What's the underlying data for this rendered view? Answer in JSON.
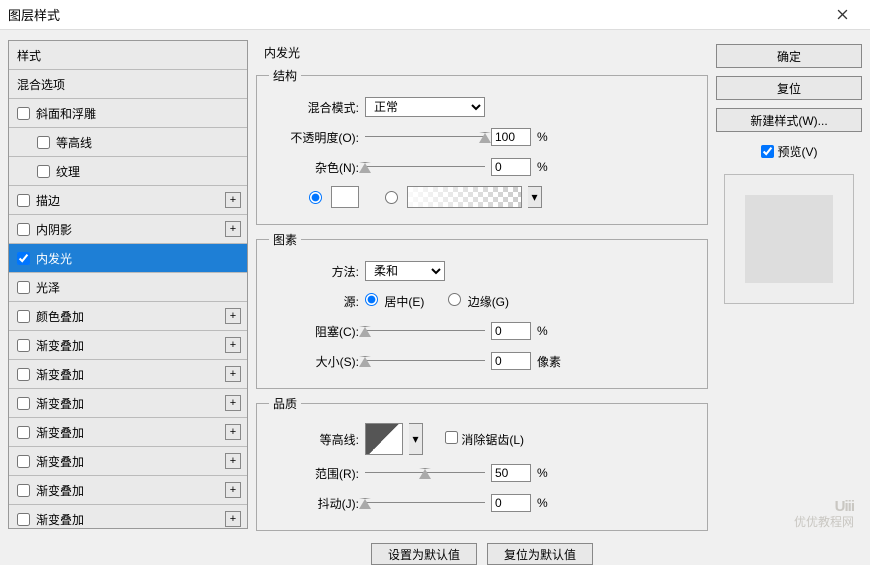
{
  "window": {
    "title": "图层样式"
  },
  "left": {
    "header1": "样式",
    "header2": "混合选项",
    "items": [
      {
        "label": "斜面和浮雕",
        "checked": false,
        "plus": false,
        "sub": false
      },
      {
        "label": "等高线",
        "checked": false,
        "plus": false,
        "sub": true
      },
      {
        "label": "纹理",
        "checked": false,
        "plus": false,
        "sub": true
      },
      {
        "label": "描边",
        "checked": false,
        "plus": true,
        "sub": false
      },
      {
        "label": "内阴影",
        "checked": false,
        "plus": true,
        "sub": false
      },
      {
        "label": "内发光",
        "checked": true,
        "plus": false,
        "sub": false,
        "selected": true
      },
      {
        "label": "光泽",
        "checked": false,
        "plus": false,
        "sub": false
      },
      {
        "label": "颜色叠加",
        "checked": false,
        "plus": true,
        "sub": false
      },
      {
        "label": "渐变叠加",
        "checked": false,
        "plus": true,
        "sub": false
      },
      {
        "label": "渐变叠加",
        "checked": false,
        "plus": true,
        "sub": false
      },
      {
        "label": "渐变叠加",
        "checked": false,
        "plus": true,
        "sub": false
      },
      {
        "label": "渐变叠加",
        "checked": false,
        "plus": true,
        "sub": false
      },
      {
        "label": "渐变叠加",
        "checked": false,
        "plus": true,
        "sub": false
      },
      {
        "label": "渐变叠加",
        "checked": false,
        "plus": true,
        "sub": false
      },
      {
        "label": "渐变叠加",
        "checked": false,
        "plus": true,
        "sub": false
      }
    ]
  },
  "mid": {
    "title": "内发光",
    "structure": {
      "legend": "结构",
      "blend_label": "混合模式:",
      "blend_value": "正常",
      "opacity_label": "不透明度(O):",
      "opacity_value": "100",
      "opacity_unit": "%",
      "noise_label": "杂色(N):",
      "noise_value": "0",
      "noise_unit": "%"
    },
    "element": {
      "legend": "图素",
      "method_label": "方法:",
      "method_value": "柔和",
      "source_label": "源:",
      "source_center": "居中(E)",
      "source_edge": "边缘(G)",
      "choke_label": "阻塞(C):",
      "choke_value": "0",
      "choke_unit": "%",
      "size_label": "大小(S):",
      "size_value": "0",
      "size_unit": "像素"
    },
    "quality": {
      "legend": "品质",
      "contour_label": "等高线:",
      "antialias_label": "消除锯齿(L)",
      "range_label": "范围(R):",
      "range_value": "50",
      "range_unit": "%",
      "jitter_label": "抖动(J):",
      "jitter_value": "0",
      "jitter_unit": "%"
    },
    "set_default": "设置为默认值",
    "reset_default": "复位为默认值"
  },
  "right": {
    "ok": "确定",
    "reset": "复位",
    "new_style": "新建样式(W)...",
    "preview": "预览(V)"
  },
  "watermark": {
    "logo": "Uiii",
    "text": "优优教程网"
  }
}
